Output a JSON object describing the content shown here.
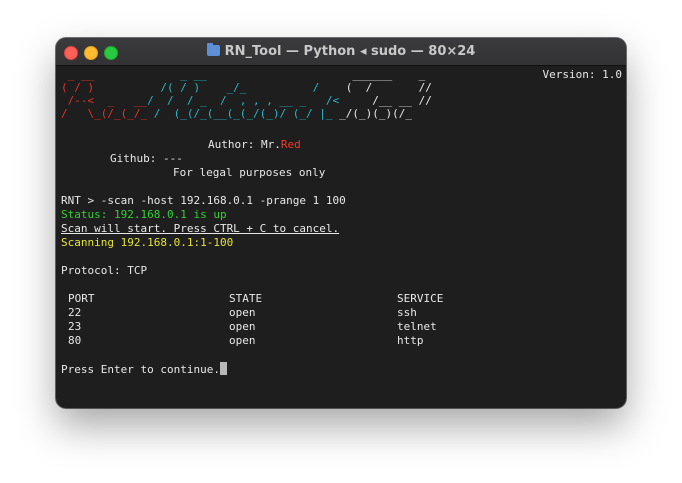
{
  "window": {
    "title": "RN_Tool — Python ◂ sudo — 80×24",
    "icon": "folder-icon"
  },
  "header": {
    "version_label": "Version: 1.0"
  },
  "banner": {
    "art_lines": [
      {
        "red": " _ __         ",
        "cyan": "    _ __                   ",
        "white": "   ______    _"
      },
      {
        "red": "( / )        ",
        "cyan": "  /( / )    _/_          /  ",
        "white": "  (  /       //"
      },
      {
        "red": " /--<  _   __",
        "cyan": "/  /  / _  /  , , , __ _   /<",
        "white": "     /__ __ //"
      },
      {
        "red": "/   \\_(/_(_/_ ",
        "cyan": "/  (_(/_(__(_(_/(_)/ (_/ |_ ",
        "white": "_/(_)(_)(/_"
      }
    ],
    "author_prefix": "Author: Mr.",
    "author_name": "Red",
    "github_line": "Github: ---",
    "legal_line": "For legal purposes only"
  },
  "session": {
    "command_line": "RNT > -scan -host 192.168.0.1 -prange 1 100",
    "status_line": "Status: 192.168.0.1 is up",
    "scan_start_line": "Scan will start. Press CTRL + C to cancel.",
    "scanning_line": "Scanning 192.168.0.1:1-100",
    "protocol_line": "Protocol: TCP",
    "continue_prompt": "Press Enter to continue."
  },
  "results": {
    "headers": [
      "PORT",
      "STATE",
      "SERVICE"
    ],
    "rows": [
      [
        "22",
        "open",
        "ssh"
      ],
      [
        "23",
        "open",
        "telnet"
      ],
      [
        "80",
        "open",
        "http"
      ]
    ]
  },
  "colors": {
    "status_green": "#32d032",
    "scanning_yellow": "#e5e52f",
    "author_red": "#ee3b2e",
    "art_red": "#e2332b",
    "art_cyan": "#27b8c6"
  }
}
